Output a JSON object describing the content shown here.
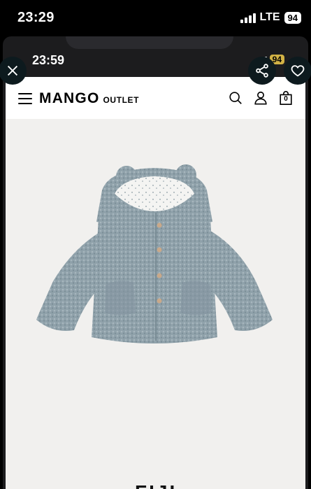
{
  "outer_status": {
    "time": "23:29",
    "network": "LTE",
    "battery": "94"
  },
  "inner_status": {
    "time": "23:59",
    "battery": "94"
  },
  "overlay": {
    "close_icon": "close-icon",
    "share_icon": "share-icon",
    "favorite_icon": "heart-icon"
  },
  "header": {
    "logo": "MANGO",
    "logo_sub": "OUTLET",
    "bag_count": "0",
    "icons": [
      "menu-icon",
      "search-icon",
      "user-icon",
      "bag-icon"
    ]
  },
  "product": {
    "image": "teddy-hooded-jacket",
    "title_partial": "FIJI"
  },
  "colors": {
    "product_bg": "#f1f0ee",
    "jacket": "#8fa1aa",
    "overlay_btn": "#0d1a1e"
  }
}
